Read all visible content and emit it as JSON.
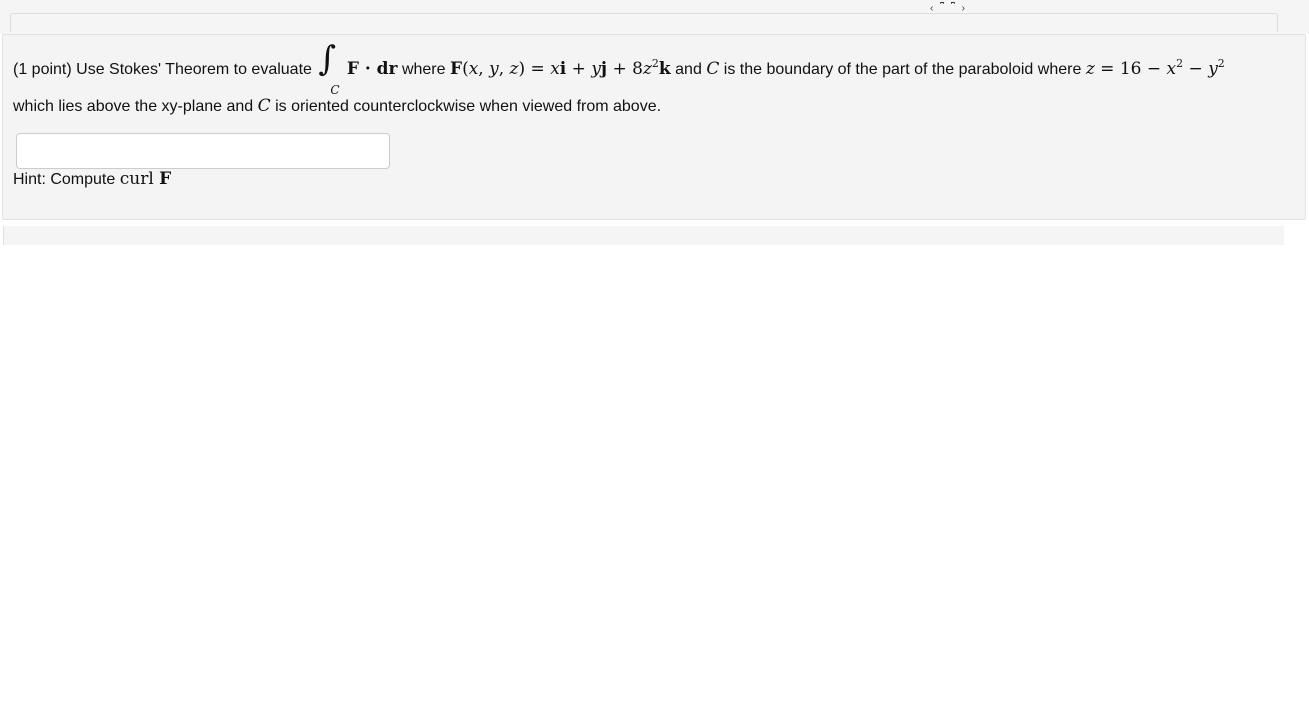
{
  "top_bar": {
    "marks": "‹ ⎴ ⎴ ›"
  },
  "problem": {
    "intro": "(1 point) Use Stokes' Theorem to evaluate",
    "integral_symbol": "∫",
    "integral_sub": "C",
    "integrand": "F · dr",
    "where1": "where",
    "field_def": "F(x, y, z) = xi + yj + 8z²k",
    "and1": "and",
    "curve": "C",
    "boundary_text": "is the boundary of the part of the paraboloid where",
    "surface_eq": "z = 16 − x² − y²",
    "line2_a": "which lies above the xy-plane and",
    "line2_b": "is oriented counterclockwise when viewed from above."
  },
  "answer": {
    "value": "",
    "placeholder": ""
  },
  "hint": {
    "label": "Hint: Compute",
    "math": "curl F"
  }
}
